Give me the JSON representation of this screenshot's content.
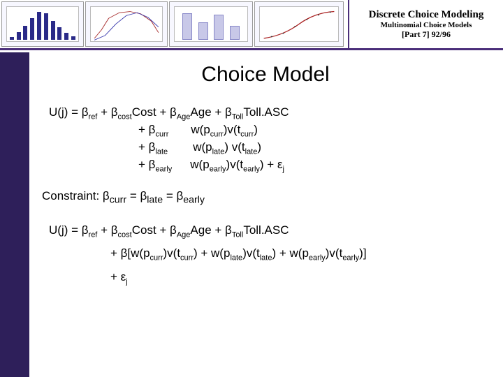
{
  "header": {
    "line1": "Discrete Choice Modeling",
    "line2": "Multinomial Choice Models",
    "line3": "[Part  7]   92/96"
  },
  "title": "Choice Model",
  "eq1": {
    "line1_pre": "U(j)  =  β",
    "line1_ref": "ref",
    "line1_a": " + β",
    "line1_cost": "cost",
    "line1_b": "Cost + β",
    "line1_age": "Age",
    "line1_c": "Age + β",
    "line1_toll": "Toll",
    "line1_d": "Toll.ASC",
    "line2_a": "+ β",
    "line2_curr": "curr",
    "line2_b": "w(p",
    "line2_c": ")v(t",
    "line2_d": ")",
    "line3_a": "+ β",
    "line3_late": "late",
    "line3_b": "w(p",
    "line3_c": ") v(t",
    "line3_d": ")",
    "line4_a": "+ β",
    "line4_early": "early",
    "line4_b": "w(p",
    "line4_c": ")v(t",
    "line4_d": ")  +  ε",
    "line4_j": "j"
  },
  "constraint": {
    "label": "Constraint: β",
    "curr": "curr",
    "eq": " = β",
    "late": "late",
    "early": "early"
  },
  "eq2": {
    "l1_pre": "U(j)  =  β",
    "ref": "ref",
    "a": " + β",
    "cost": "cost",
    "b": "Cost + β",
    "age": "Age",
    "c": "Age + β",
    "toll": "Toll",
    "d": "Toll.ASC",
    "l2_a": "+ β[w(p",
    "curr": "curr",
    "l2_b": ")v(t",
    "l2_c": ") + w(p",
    "late": "late",
    "l2_d": ")v(t",
    "l2_e": ") + w(p",
    "early": "early",
    "l2_f": ")v(t",
    "l2_g": ")]",
    "l3_a": "+  ε",
    "j": "j"
  }
}
